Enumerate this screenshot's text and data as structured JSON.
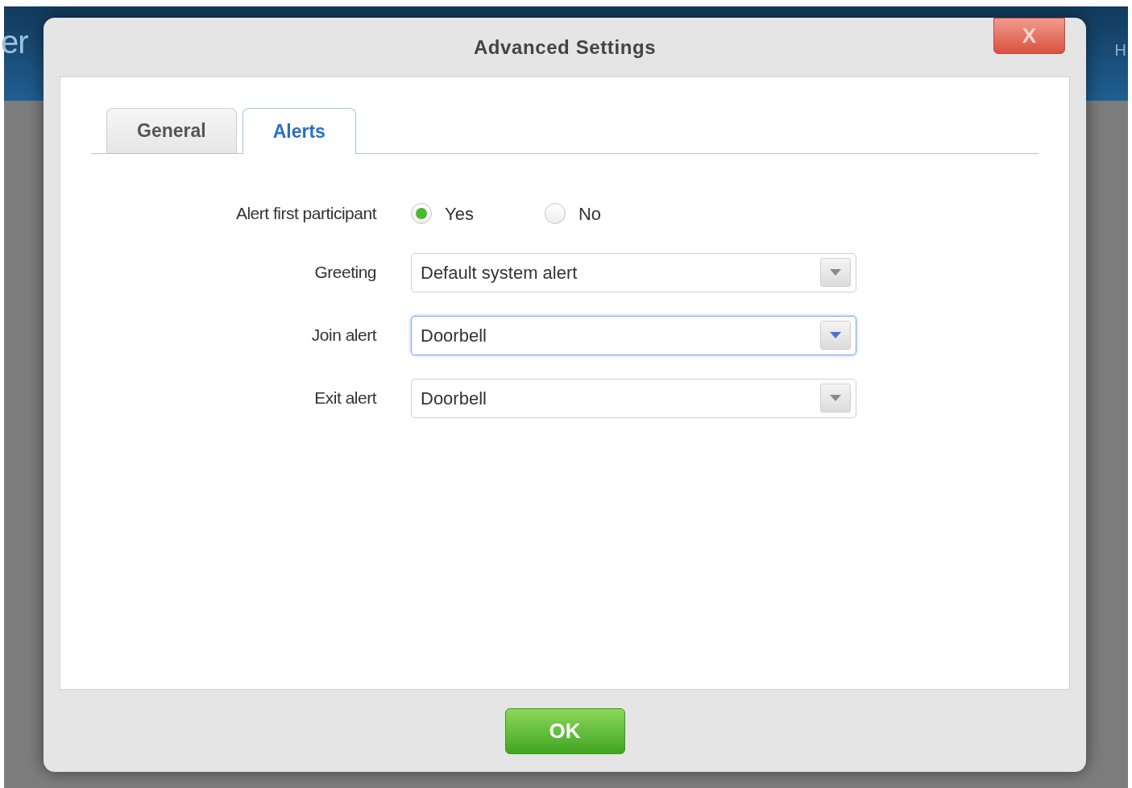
{
  "background": {
    "header_text_left": "er",
    "header_text_right": "H"
  },
  "dialog": {
    "title": "Advanced Settings",
    "close_label": "X",
    "tabs": [
      {
        "label": "General",
        "selected": false
      },
      {
        "label": "Alerts",
        "selected": true
      }
    ],
    "radio_row": {
      "label": "Alert first participant",
      "options": [
        {
          "label": "Yes",
          "selected": true
        },
        {
          "label": "No",
          "selected": false
        }
      ]
    },
    "selects": [
      {
        "label": "Greeting",
        "value": "Default system alert",
        "focused": false
      },
      {
        "label": "Join alert",
        "value": "Doorbell",
        "focused": true
      },
      {
        "label": "Exit alert",
        "value": "Doorbell",
        "focused": false
      }
    ],
    "ok_button": "OK"
  }
}
